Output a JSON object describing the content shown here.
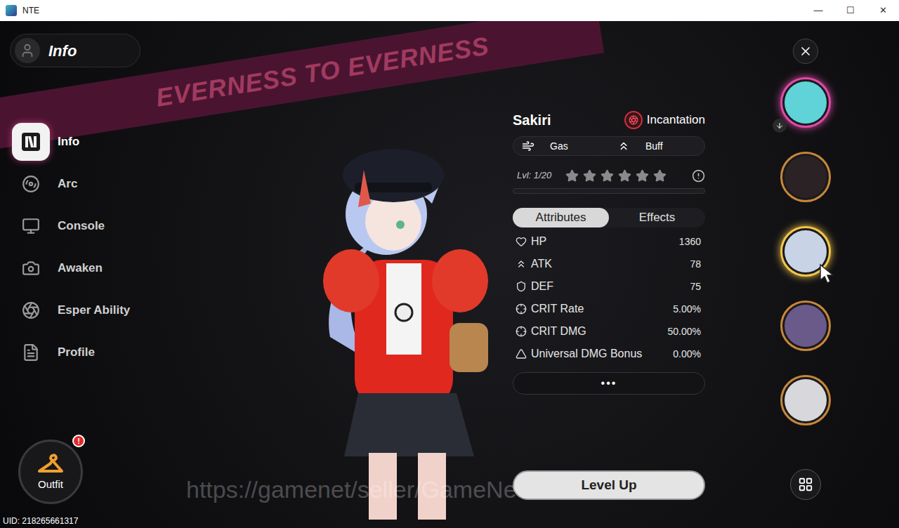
{
  "window": {
    "title": "NTE",
    "controls": [
      "—",
      "☐",
      "✕"
    ]
  },
  "header": {
    "title": "Info"
  },
  "banner": "EVERNESS TO EVERNESS",
  "menu": [
    {
      "label": "Info",
      "selected": true
    },
    {
      "label": "Arc",
      "selected": false
    },
    {
      "label": "Console",
      "selected": false
    },
    {
      "label": "Awaken",
      "selected": false
    },
    {
      "label": "Esper Ability",
      "selected": false
    },
    {
      "label": "Profile",
      "selected": false
    }
  ],
  "outfit": {
    "label": "Outfit",
    "badge": "!"
  },
  "uid": "UID: 218265661317",
  "watermark": "https://gamenet/seller/GameNe",
  "character": {
    "name": "Sakiri",
    "element": "Incantation",
    "tags": [
      "Gas",
      "Buff"
    ],
    "level_text": "Lvl: 1/20",
    "stars": 0,
    "star_total": 6,
    "exp_level": 0
  },
  "tabs": [
    {
      "label": "Attributes",
      "selected": true
    },
    {
      "label": "Effects",
      "selected": false
    }
  ],
  "attributes": [
    {
      "label": "HP",
      "value": "1360"
    },
    {
      "label": "ATK",
      "value": "78"
    },
    {
      "label": "DEF",
      "value": "75"
    },
    {
      "label": "CRIT Rate",
      "value": "5.00%"
    },
    {
      "label": "CRIT DMG",
      "value": "50.00%"
    },
    {
      "label": "Universal DMG Bonus",
      "value": "0.00%"
    }
  ],
  "more_button": "•••",
  "level_up_button": "Level Up",
  "roster": [
    {
      "selected": true,
      "hovered": false,
      "color": "#5fd3d8"
    },
    {
      "selected": false,
      "hovered": false,
      "color": "#2b2226"
    },
    {
      "selected": false,
      "hovered": true,
      "color": "#c9d3e6"
    },
    {
      "selected": false,
      "hovered": false,
      "color": "#6a5a8a"
    },
    {
      "selected": false,
      "hovered": false,
      "color": "#d8d8dc"
    }
  ]
}
